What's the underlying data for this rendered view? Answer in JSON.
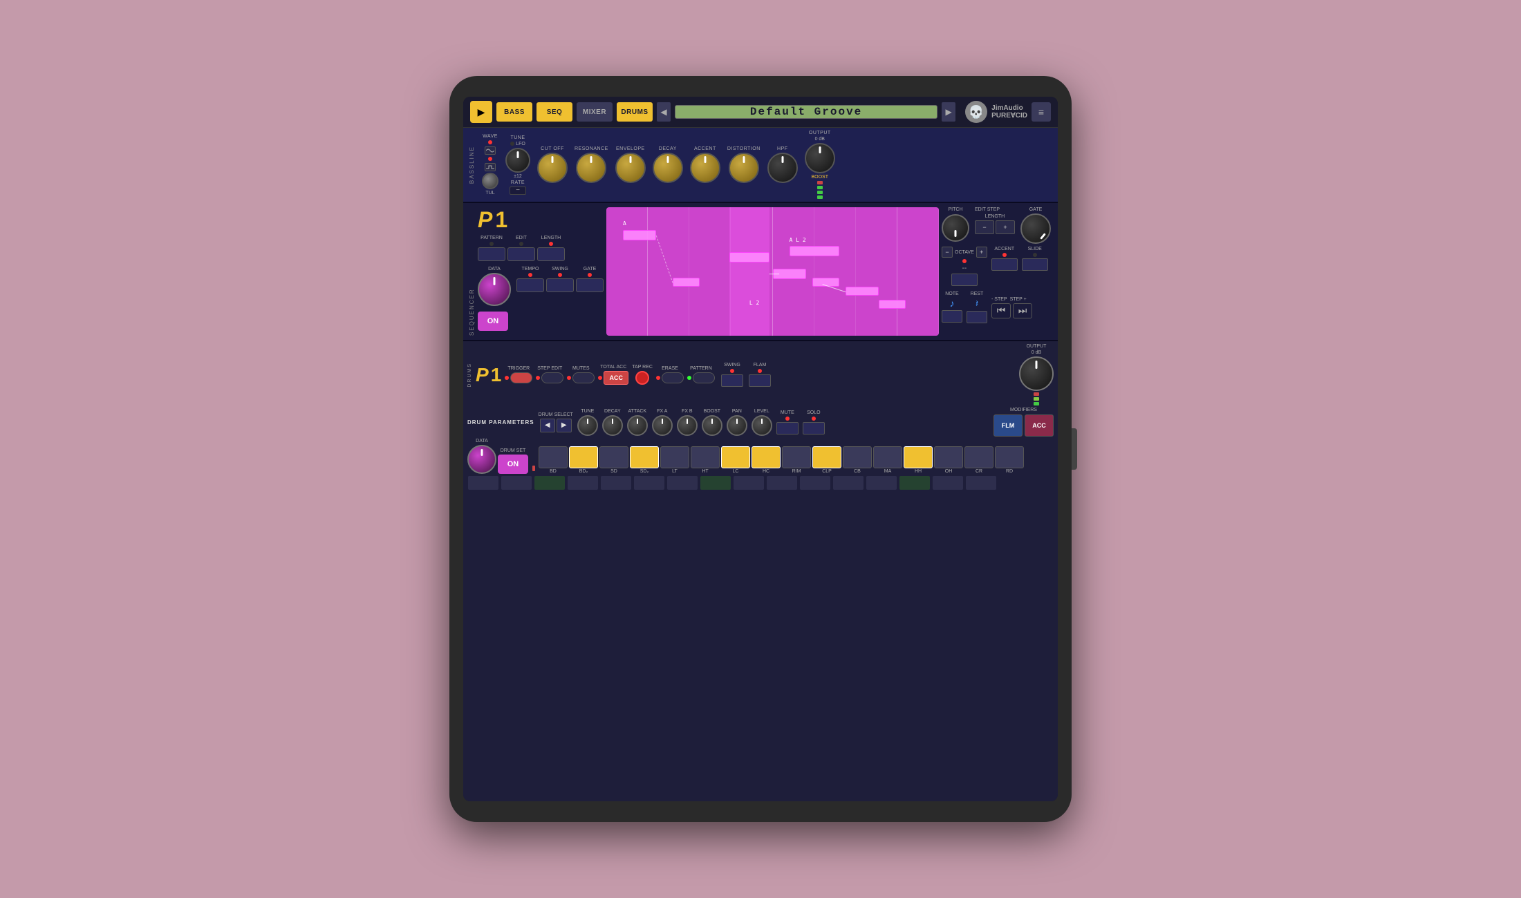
{
  "app": {
    "title": "PURE∀CID",
    "company": "JimAudio",
    "skull_icon": "💀",
    "preset_name": "Default Groove"
  },
  "top_bar": {
    "play_label": "▶",
    "nav_buttons": [
      "BASS",
      "SEQ",
      "MIXER",
      "DRUMS"
    ],
    "active_tab": "DRUMS",
    "prev_arrow": "◀",
    "next_arrow": "▶",
    "menu_icon": "≡"
  },
  "bassline": {
    "section_label": "BASSLINE",
    "knobs": [
      {
        "label": "WAVE",
        "type": "dark"
      },
      {
        "label": "TUNE",
        "type": "dark"
      },
      {
        "label": "LFO / RATE",
        "type": "dark"
      },
      {
        "label": "CUT OFF",
        "type": "gold"
      },
      {
        "label": "RESONANCE",
        "type": "gold"
      },
      {
        "label": "ENVELOPE",
        "type": "gold"
      },
      {
        "label": "DECAY",
        "type": "gold"
      },
      {
        "label": "ACCENT",
        "type": "gold"
      },
      {
        "label": "DISTORTION",
        "type": "gold"
      },
      {
        "label": "HPF",
        "type": "dark"
      },
      {
        "label": "OUTPUT",
        "type": "dark"
      }
    ],
    "output_label": "OUTPUT",
    "boost_label": "BOOST"
  },
  "sequencer": {
    "section_label": "SEQUENCER",
    "pattern_num": "1",
    "p_letter": "P",
    "buttons": {
      "pattern_label": "PATTERN",
      "edit_label": "EDIT",
      "length_label": "LENGTH",
      "tempo_label": "TEMPO",
      "swing_label": "SWING",
      "gate_label": "GATE"
    },
    "on_label": "ON",
    "data_label": "DATA",
    "pitch_label": "PITCH",
    "edit_step_label": "EDIT STEP",
    "gate_label": "GATE",
    "length_label": "LENGTH",
    "minus_label": "−",
    "plus_label": "+",
    "octave_label": "OCTAVE",
    "accent_label": "ACCENT",
    "slide_label": "SLIDE",
    "note_label": "NOTE",
    "rest_label": "REST",
    "step_minus_label": "- STEP",
    "step_plus_label": "STEP +",
    "piano_labels": [
      "A",
      "L 2",
      "A  L 2"
    ],
    "octave_symbols": [
      "-",
      "--",
      "+"
    ]
  },
  "drums": {
    "section_label": "DRUMS",
    "pattern_num": "1",
    "p_letter": "P",
    "controls": {
      "trigger_label": "TRIGGER",
      "step_edit_label": "STEP EDIT",
      "mutes_label": "MUTES",
      "total_acc_label": "TOTAL ACC",
      "tap_rec_label": "TAP REC",
      "erase_label": "ERASE",
      "pattern_label": "PATTERN",
      "acc_label": "ACC",
      "swing_label": "SWING",
      "flam_label": "FLAM",
      "output_label": "OUTPUT"
    },
    "params": {
      "title": "DRUM PARAMETERS",
      "drum_select_label": "DRUM SELECT",
      "tune_label": "TUNE",
      "decay_label": "DECAY",
      "attack_label": "ATTACK",
      "fx_a_label": "FX A",
      "fx_b_label": "FX B",
      "boost_label": "BOOST",
      "pan_label": "PAN",
      "level_label": "LEVEL",
      "mute_label": "MUTE",
      "solo_label": "SOLO"
    },
    "modifiers": {
      "title": "MODIFIERS",
      "flm_label": "FLM",
      "acc_label": "ACC"
    },
    "drum_set_label": "DRUM SET",
    "on_label": "ON",
    "pads": [
      "BD",
      "BD2",
      "SD",
      "SD2",
      "LT",
      "HT",
      "LC",
      "HC",
      "RIM",
      "CLP",
      "CB",
      "MA",
      "HH",
      "OH",
      "CR",
      "RD"
    ],
    "active_pads": [
      1,
      3,
      5,
      7,
      9,
      13
    ],
    "data_label": "DATA"
  }
}
